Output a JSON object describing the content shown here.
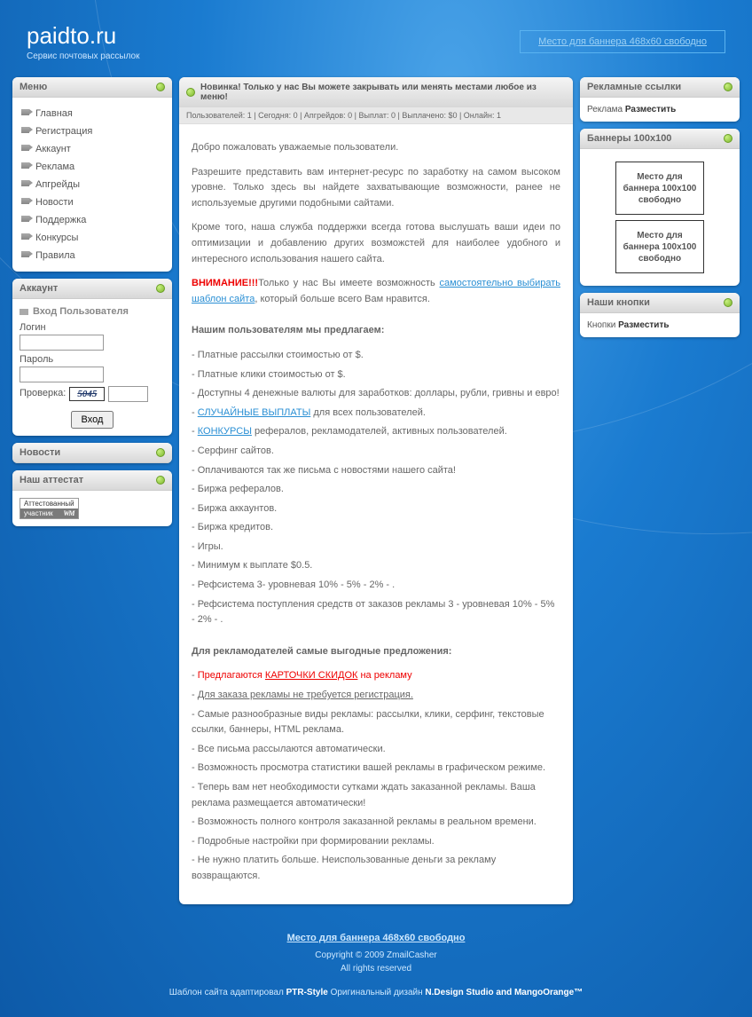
{
  "header": {
    "title": "paidto.ru",
    "subtitle": "Сервис почтовых рассылок",
    "banner_text": "Место для баннера 468х60 свободно"
  },
  "sidebar": {
    "menu_title": "Меню",
    "items": [
      "Главная",
      "Регистрация",
      "Аккаунт",
      "Реклама",
      "Апгрейды",
      "Новости",
      "Поддержка",
      "Конкурсы",
      "Правила"
    ],
    "account_title": "Аккаунт",
    "login_heading": "Вход Пользователя",
    "login_label": "Логин",
    "password_label": "Пароль",
    "captcha_label": "Проверка:",
    "captcha_value": "5045",
    "login_button": "Вход",
    "news_title": "Новости",
    "attest_title": "Наш аттестат",
    "attest_top": "Аттестованный",
    "attest_bot_left": "участник",
    "attest_bot_right": "WM"
  },
  "center": {
    "headline": "Новинка! Только у нас Вы можете закрывать или менять местами любое из меню!",
    "stats": "Пользователей: 1  |  Сегодня: 0  |  Апгрейдов: 0  |  Выплат: 0  |  Выплачено: $0  |  Онлайн: 1",
    "welcome_p1": "Добро пожаловать уважаемые пользователи.",
    "welcome_p2": "Разрешите представить вам интернет-ресурс по заработку на самом высоком уровне. Только здесь вы найдете захватывающие возможности, ранее не используемые другими подобными сайтами.",
    "welcome_p3": "Кроме того, наша служба поддержки всегда готова выслушать ваши идеи по оптимизации и добавлению других возможстей для наиболее удобного и интересного использования нашего сайта.",
    "warn_prefix": "ВНИМАНИЕ!!!",
    "warn_text": "Только у нас Вы имеете возможность ",
    "warn_link": "самостоятельно выбирать шаблон сайта",
    "warn_suffix": ", который больше всего Вам нравится.",
    "users_title": "Нашим пользователям мы предлагаем:",
    "users_items": [
      {
        "t": "Платные рассылки стоимостью от $."
      },
      {
        "t": "Платные клики стоимостью от $."
      },
      {
        "t": "Доступны 4 денежные валюты для заработков: доллары, рубли, гривны и евро!"
      },
      {
        "link": "СЛУЧАЙНЫЕ ВЫПЛАТЫ",
        "after": " для всех пользователей."
      },
      {
        "link": "КОНКУРСЫ",
        "after": " рефералов, рекламодателей, активных пользователей."
      },
      {
        "t": "Серфинг сайтов."
      },
      {
        "t": "Оплачиваются так же письма с новостями нашего сайта!"
      },
      {
        "t": "Биржа рефералов."
      },
      {
        "t": "Биржа аккаунтов."
      },
      {
        "t": "Биржа кредитов."
      },
      {
        "t": "Игры."
      },
      {
        "t": "Минимум к выплате $0.5."
      },
      {
        "t": "Рефсистема 3- уровневая 10% - 5% - 2% - ."
      },
      {
        "t": "Рефсистема поступления средств от заказов рекламы 3 - уровневая 10% - 5% - 2% - ."
      }
    ],
    "adv_title": "Для рекламодателей самые выгодные предложения:",
    "adv_line1_pre": "Предлагаются ",
    "adv_line1_link": "КАРТОЧКИ СКИДОК",
    "adv_line1_post": " на рекламу",
    "adv_line2": "Для заказа рекламы не требуется регистрация.",
    "adv_items": [
      "Самые разнообразные виды рекламы: рассылки, клики, серфинг, текстовые ссылки, баннеры, HTML реклама.",
      "Все письма рассылаются автоматически.",
      "Возможность просмотра статистики вашей рекламы в графическом режиме.",
      "Теперь вам нет необходимости сутками ждать заказанной рекламы. Ваша реклама размещается автоматически!",
      "Возможность полного контроля заказанной рекламы в реальном времени.",
      "Подробные настройки при формировании рекламы.",
      "Не нужно платить больше. Неиспользованные деньги за рекламу возвращаются."
    ]
  },
  "right": {
    "ad_links_title": "Рекламные ссылки",
    "ad_text": "Реклама ",
    "ad_place": "Разместить",
    "banners_title": "Баннеры 100х100",
    "banner_line1": "Место для",
    "banner_line2": "баннера 100х100",
    "banner_line3": "свободно",
    "buttons_title": "Наши кнопки",
    "buttons_text": "Кнопки ",
    "buttons_place": "Разместить"
  },
  "footer": {
    "banner": "Место для баннера 468х60 свободно",
    "copyright": "Copyright © 2009 ZmailCasher",
    "rights": "All rights reserved",
    "credit_pre": "Шаблон сайта адаптировал ",
    "credit_b1": "PTR-Style",
    "credit_mid": " Оригинальный дизайн ",
    "credit_b2": "N.Design Studio and MangoOrange™"
  }
}
